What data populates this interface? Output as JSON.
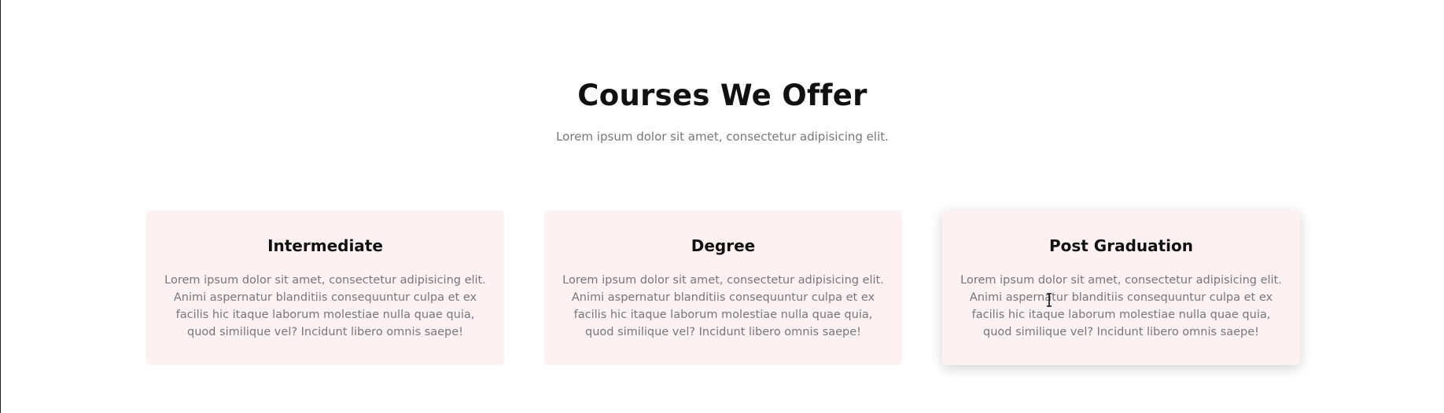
{
  "section": {
    "title": "Courses We Offer",
    "subtitle": "Lorem ipsum dolor sit amet, consectetur adipisicing elit."
  },
  "cards": [
    {
      "title": "Intermediate",
      "text": "Lorem ipsum dolor sit amet, consectetur adipisicing elit. Animi aspernatur blanditiis consequuntur culpa et ex facilis hic itaque laborum molestiae nulla quae quia, quod similique vel? Incidunt libero omnis saepe!"
    },
    {
      "title": "Degree",
      "text": "Lorem ipsum dolor sit amet, consectetur adipisicing elit. Animi aspernatur blanditiis consequuntur culpa et ex facilis hic itaque laborum molestiae nulla quae quia, quod similique vel? Incidunt libero omnis saepe!"
    },
    {
      "title": "Post Graduation",
      "text": "Lorem ipsum dolor sit amet, consectetur adipisicing elit. Animi aspernatur blanditiis consequuntur culpa et ex facilis hic itaque laborum molestiae nulla quae quia, quod similique vel? Incidunt libero omnis saepe!"
    }
  ],
  "colors": {
    "card_background": "#fdf1f1",
    "heading": "#111111",
    "body_text": "#777777"
  },
  "icons": {
    "cursor": "text-cursor-icon"
  }
}
